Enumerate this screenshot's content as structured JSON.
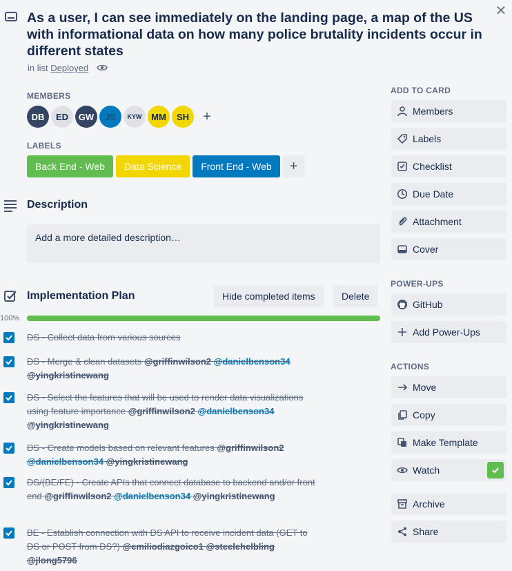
{
  "card": {
    "title": "As a user, I can see immediately on the landing page, a map of the US with informational data on how many police brutality incidents occur in different states",
    "in_list_prefix": "in list",
    "list_name": "Deployed"
  },
  "members": {
    "heading": "MEMBERS",
    "items": [
      {
        "initials": "DB",
        "bg": "#344563",
        "fg": "#ffffff"
      },
      {
        "initials": "ED",
        "bg": "#dfe1e6",
        "fg": "#172b4d"
      },
      {
        "initials": "GW",
        "bg": "#344563",
        "fg": "#ffffff"
      },
      {
        "initials": "JS",
        "bg": "#0079bf",
        "fg": "#1c4f7a"
      },
      {
        "initials": "KYW",
        "bg": "#dfe1e6",
        "fg": "#172b4d"
      },
      {
        "initials": "MM",
        "bg": "#f2d600",
        "fg": "#172b4d"
      },
      {
        "initials": "SH",
        "bg": "#f2d600",
        "fg": "#172b4d"
      }
    ],
    "add_symbol": "+"
  },
  "labels": {
    "heading": "LABELS",
    "items": [
      {
        "text": "Back End - Web",
        "color": "#61bd4f"
      },
      {
        "text": "Data Science",
        "color": "#f2d600"
      },
      {
        "text": "Front End - Web",
        "color": "#0079bf"
      }
    ],
    "add_symbol": "+"
  },
  "description": {
    "heading": "Description",
    "placeholder": "Add a more detailed description…"
  },
  "checklist": {
    "title": "Implementation Plan",
    "hide_completed_label": "Hide completed items",
    "delete_label": "Delete",
    "progress_text": "100%",
    "progress": 1.0,
    "items": [
      {
        "text": "DS - Collect data from various sources",
        "mentions": []
      },
      {
        "text": "DS - Merge & clean datasets",
        "mentions": [
          "@griffinwilson2",
          "@danielbenson34",
          "@yingkristinewang"
        ]
      },
      {
        "text": "DS - Select the features that will be used to render data visualizations using feature importance",
        "mentions": [
          "@griffinwilson2",
          "@danielbenson34",
          "@yingkristinewang"
        ]
      },
      {
        "text": "DS - Create models based on relevant features",
        "mentions": [
          "@griffinwilson2",
          "@danielbenson34",
          "@yingkristinewang"
        ]
      },
      {
        "text": "DS/(BE/FE) - Create APIs that connect database to backend and/or front end",
        "mentions": [
          "@griffinwilson2",
          "@danielbenson34",
          "@yingkristinewang"
        ]
      },
      {
        "text": "BE - Establish connection with DS API to receive incident data (GET to DS or POST from DS?)",
        "mentions": [
          "@emiliodiazgoico1",
          "@steelehelbling",
          "@jlong5796"
        ]
      }
    ]
  },
  "sidebar": {
    "add_to_card_heading": "ADD TO CARD",
    "add_to_card": [
      {
        "label": "Members",
        "icon": "person-icon"
      },
      {
        "label": "Labels",
        "icon": "tag-icon"
      },
      {
        "label": "Checklist",
        "icon": "checklist-icon"
      },
      {
        "label": "Due Date",
        "icon": "clock-icon"
      },
      {
        "label": "Attachment",
        "icon": "paperclip-icon"
      },
      {
        "label": "Cover",
        "icon": "cover-icon"
      }
    ],
    "powerups_heading": "POWER-UPS",
    "powerups": [
      {
        "label": "GitHub",
        "icon": "github-icon"
      },
      {
        "label": "Add Power-Ups",
        "icon": "plus-icon"
      }
    ],
    "actions_heading": "ACTIONS",
    "actions": [
      {
        "label": "Move",
        "icon": "arrow-right-icon"
      },
      {
        "label": "Copy",
        "icon": "copy-icon"
      },
      {
        "label": "Make Template",
        "icon": "template-icon"
      },
      {
        "label": "Watch",
        "icon": "eye-icon",
        "checked": true
      },
      {
        "label": "Archive",
        "icon": "archive-icon"
      },
      {
        "label": "Share",
        "icon": "share-icon"
      }
    ]
  },
  "colors": {
    "accent": "#0079bf",
    "success": "#61bd4f"
  }
}
